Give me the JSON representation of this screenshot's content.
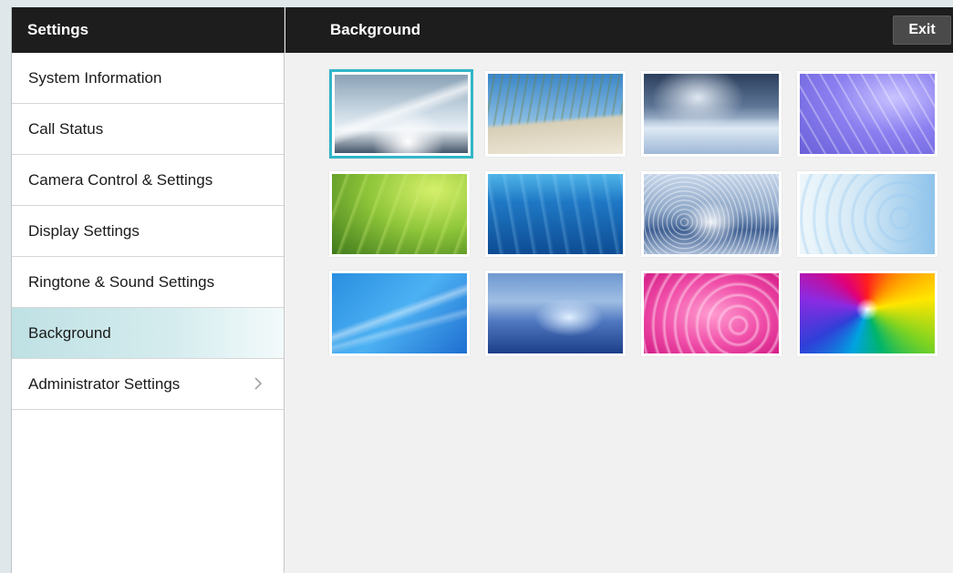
{
  "sidebar": {
    "header_title": "Settings",
    "items": [
      {
        "label": "System Information"
      },
      {
        "label": "Call Status"
      },
      {
        "label": "Camera Control & Settings"
      },
      {
        "label": "Display Settings"
      },
      {
        "label": "Ringtone & Sound Settings"
      },
      {
        "label": "Background",
        "active": true
      },
      {
        "label": "Administrator Settings",
        "has_submenu": true,
        "chevron_icon": "chevron-right-icon"
      }
    ]
  },
  "main": {
    "title": "Background",
    "exit_label": "Exit",
    "selected_index": 0
  },
  "colors": {
    "header_bg": "#1d1d1d",
    "accent_selection": "#31b6c9",
    "active_item_bg": "#bfe1e4",
    "content_bg": "#f1f1f1"
  }
}
